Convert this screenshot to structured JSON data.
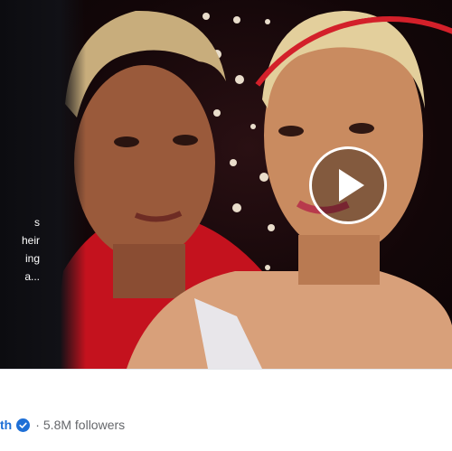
{
  "video": {
    "teaser_lines": [
      "s",
      "heir",
      "ing",
      "a..."
    ],
    "play_icon": "play-icon"
  },
  "footer": {
    "author_name": "th",
    "verified_icon": "verified-badge-icon",
    "separator": "·",
    "followers": "5.8M followers"
  },
  "colors": {
    "accent_red": "#d3202a",
    "link_blue": "#1d6fd6",
    "muted_text": "#65676b"
  }
}
